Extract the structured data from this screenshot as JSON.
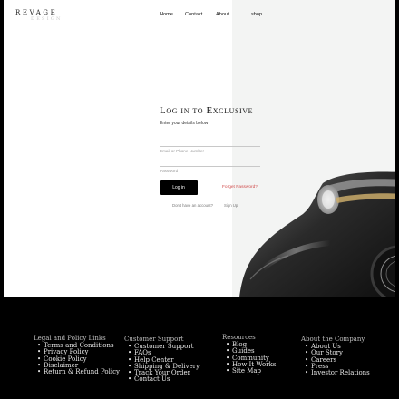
{
  "brand": {
    "logo_main": "REVAGE",
    "logo_sub": "DESIGN"
  },
  "nav": {
    "home": "Home",
    "contact": "Contact",
    "about": "About",
    "shop": "shop"
  },
  "login": {
    "title": "Log in to Exclusive",
    "subtitle": "Enter your details below",
    "email_placeholder": "Email or Phone Number",
    "password_placeholder": "Password",
    "login_button": "Log in",
    "forgot_password": "Forget Password?",
    "no_account": "Don't have an account?",
    "signup": "Sign Up"
  },
  "footer": {
    "columns": [
      {
        "title": "Legal and Policy Links",
        "items": [
          "Terms and Conditions",
          "Privacy Policy",
          "Cookie Policy",
          "Disclaimer",
          "Return & Refund Policy"
        ]
      },
      {
        "title": "Customer Support",
        "items": [
          "Customer Support",
          "FAQs",
          "Help Center",
          "Shipping & Delivery",
          "Track Your Order",
          "Contact Us"
        ]
      },
      {
        "title": "Resources",
        "items": [
          "Blog",
          "Guides",
          "Community",
          "How It Works",
          "Site Map"
        ]
      },
      {
        "title": "About the Company",
        "items": [
          "About Us",
          "Our Story",
          "Careers",
          "Press",
          "Investor Relations"
        ]
      }
    ]
  },
  "colors": {
    "accent_red": "#d04b4b",
    "button_bg": "#000000",
    "panel_bg": "#f3f4f3"
  },
  "icons": {
    "hero_image": "classic-car-image"
  }
}
